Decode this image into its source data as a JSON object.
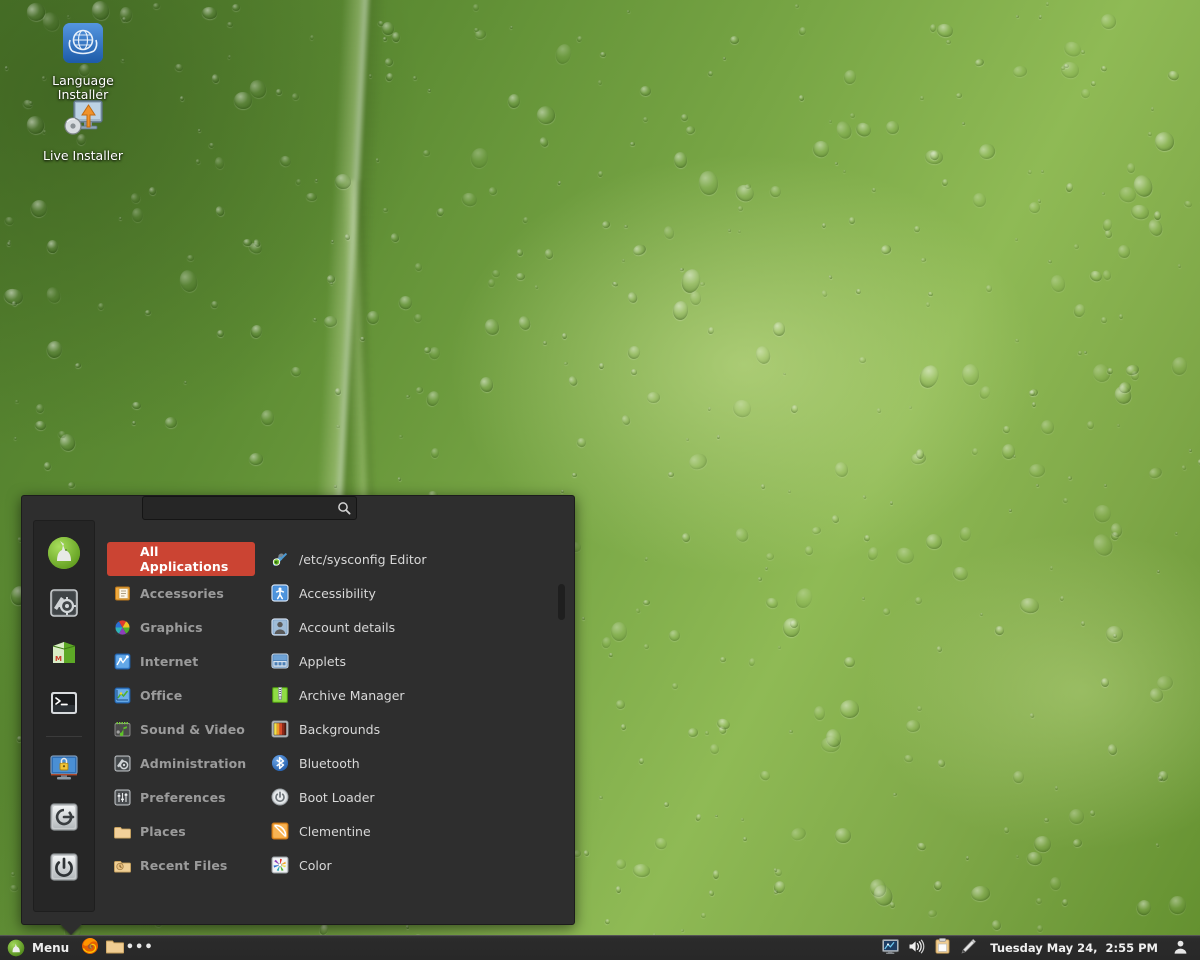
{
  "desktop": {
    "icons": [
      {
        "label": "Language Installer",
        "icon": "un-globe-icon"
      },
      {
        "label": "Live Installer",
        "icon": "monitor-upload-icon"
      }
    ]
  },
  "menu": {
    "search": {
      "value": "",
      "placeholder": "",
      "icon": "search-icon"
    },
    "sidebar": [
      {
        "name": "mint-logo-icon",
        "tooltip": "Linux Mint"
      },
      {
        "name": "system-settings-icon",
        "tooltip": "System Settings"
      },
      {
        "name": "software-manager-icon",
        "tooltip": "Software Manager"
      },
      {
        "name": "terminal-icon",
        "tooltip": "Terminal"
      },
      {
        "name": "lock-screen-icon",
        "tooltip": "Lock Screen"
      },
      {
        "name": "logout-icon",
        "tooltip": "Log Out"
      },
      {
        "name": "shutdown-icon",
        "tooltip": "Quit"
      }
    ],
    "categories": [
      {
        "label": "All Applications",
        "icon": "all-applications-icon",
        "selected": true
      },
      {
        "label": "Accessories",
        "icon": "accessories-icon",
        "selected": false
      },
      {
        "label": "Graphics",
        "icon": "graphics-icon",
        "selected": false
      },
      {
        "label": "Internet",
        "icon": "internet-icon",
        "selected": false
      },
      {
        "label": "Office",
        "icon": "office-icon",
        "selected": false
      },
      {
        "label": "Sound & Video",
        "icon": "sound-video-icon",
        "selected": false
      },
      {
        "label": "Administration",
        "icon": "administration-icon",
        "selected": false
      },
      {
        "label": "Preferences",
        "icon": "preferences-icon",
        "selected": false
      },
      {
        "label": "Places",
        "icon": "places-folder-icon",
        "selected": false
      },
      {
        "label": "Recent Files",
        "icon": "recent-files-icon",
        "selected": false
      }
    ],
    "applications": [
      {
        "label": "/etc/sysconfig Editor",
        "icon": "sysconfig-editor-icon"
      },
      {
        "label": "Accessibility",
        "icon": "accessibility-icon"
      },
      {
        "label": "Account details",
        "icon": "account-details-icon"
      },
      {
        "label": "Applets",
        "icon": "applets-icon"
      },
      {
        "label": "Archive Manager",
        "icon": "archive-manager-icon"
      },
      {
        "label": "Backgrounds",
        "icon": "backgrounds-icon"
      },
      {
        "label": "Bluetooth",
        "icon": "bluetooth-icon"
      },
      {
        "label": "Boot Loader",
        "icon": "boot-loader-icon"
      },
      {
        "label": "Clementine",
        "icon": "clementine-icon"
      },
      {
        "label": "Color",
        "icon": "color-icon"
      }
    ],
    "colors": {
      "panel_bg": "#2e2e2e",
      "selection": "#cb4433",
      "category_text": "#9b9b9b",
      "app_text": "#d8d8d8"
    }
  },
  "taskbar": {
    "menu_button": {
      "label": "Menu",
      "icon": "mint-logo-icon"
    },
    "launchers": [
      {
        "name": "firefox-icon"
      },
      {
        "name": "file-manager-icon"
      },
      {
        "name": "overflow-icon",
        "label": "•••"
      }
    ],
    "tray": [
      {
        "name": "network-monitor-icon"
      },
      {
        "name": "volume-icon"
      },
      {
        "name": "clipboard-icon"
      },
      {
        "name": "pen-icon"
      }
    ],
    "clock": "Tuesday May 24,  2:55 PM",
    "user": {
      "name": "user-avatar-icon"
    }
  }
}
